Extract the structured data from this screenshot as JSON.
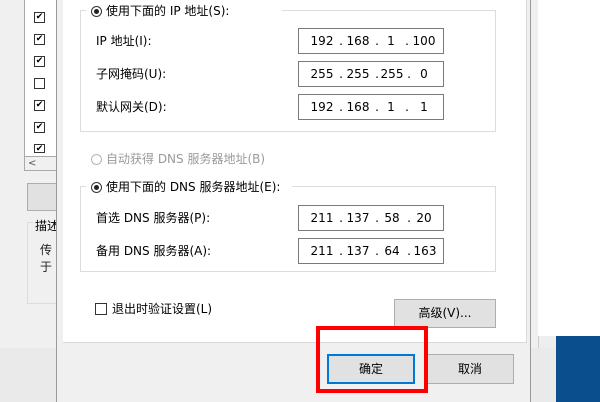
{
  "background": {
    "checkboxes": [
      true,
      true,
      true,
      false,
      true,
      true,
      true
    ],
    "description_group_label": "描述",
    "description_lines": [
      "传",
      "于"
    ]
  },
  "dialog": {
    "ip_section": {
      "use_following_label": "使用下面的 IP 地址(S):",
      "fields": [
        {
          "label": "IP 地址(I):",
          "value": [
            "192",
            "168",
            "1",
            "100"
          ]
        },
        {
          "label": "子网掩码(U):",
          "value": [
            "255",
            "255",
            "255",
            "0"
          ]
        },
        {
          "label": "默认网关(D):",
          "value": [
            "192",
            "168",
            "1",
            "1"
          ]
        }
      ]
    },
    "dns_section": {
      "auto_label": "自动获得 DNS 服务器地址(B)",
      "use_following_label": "使用下面的 DNS 服务器地址(E):",
      "fields": [
        {
          "label": "首选 DNS 服务器(P):",
          "value": [
            "211",
            "137",
            "58",
            "20"
          ]
        },
        {
          "label": "备用 DNS 服务器(A):",
          "value": [
            "211",
            "137",
            "64",
            "163"
          ]
        }
      ]
    },
    "validate_label": "退出时验证设置(L)",
    "advanced_button": "高级(V)...",
    "ok_button": "确定",
    "cancel_button": "取消"
  },
  "colors": {
    "highlight": "#ff0000",
    "taskbar": "#0b4e8e",
    "default_button_border": "#0078d7"
  }
}
